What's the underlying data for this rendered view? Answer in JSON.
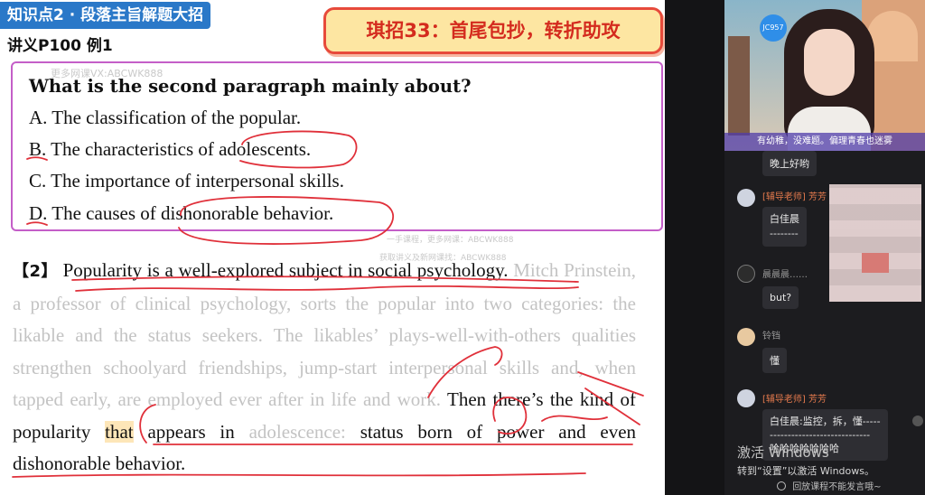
{
  "slide": {
    "topic_tag": "知识点2 · 段落主旨解题大招",
    "lecture_ref": "讲义P100 例1",
    "tip_banner": "琪招33：首尾包抄，转折助攻",
    "watermarks": [
      "更多网课VX:ABCWK888",
      "一手课程，更多网课：ABCWK888",
      "获取讲义及新网课找：ABCWK888"
    ],
    "question": {
      "stem": "What is the second paragraph mainly about?",
      "options": [
        "A. The classification of the popular.",
        "B. The characteristics of adolescents.",
        "C. The importance of interpersonal skills.",
        "D. The causes of dishonorable behavior."
      ]
    },
    "passage": {
      "para_num": "【2】",
      "topic_sentence": "Popularity is a well-explored subject in social psychology.",
      "faded_text": "Mitch Prinstein, a professor of clinical psychology, sorts the popular into two categories: the likable and the status seekers. The likables’ plays-well-with-others qualities strengthen schoolyard friendships, jump-start interpersonal skills and, when tapped early, are employed ever after in life and work.",
      "closing_a": "Then there’s the kind of popularity",
      "closing_highlight": "that",
      "closing_b": "appears in",
      "closing_faded": "adolescence:",
      "closing_c": "status born of power and even dishonorable behavior."
    }
  },
  "video": {
    "logo_text": "JC957",
    "caption": "有幼稚，没难题。偏理青春也迷雾"
  },
  "chat": {
    "messages": [
      {
        "name": "",
        "text": "晚上好哟",
        "teacher": false
      },
      {
        "name": "[辅导老师] 芳芳",
        "text": "白佳晨",
        "text2": "--------",
        "teacher": true
      },
      {
        "name": "晨晨晨……",
        "text": "but?",
        "teacher": false
      },
      {
        "name": "铃铛",
        "text": "懂",
        "teacher": false
      },
      {
        "name": "[辅导老师] 芳芳",
        "text": "白佳晨:监控，拆，懂-----",
        "text2": "----------------------------",
        "text3": "哈哈哈哈哈哈哈",
        "teacher": true
      }
    ]
  },
  "system": {
    "activate_title": "激活 Windows",
    "activate_hint": "转到“设置”以激活 Windows。",
    "playback_hint": "回放课程不能发言哦~"
  },
  "colors": {
    "accent_blue": "#2a78c8",
    "annotation_red": "#e0303a",
    "question_border": "#c45ec8",
    "banner_bg": "#fde6a2"
  }
}
